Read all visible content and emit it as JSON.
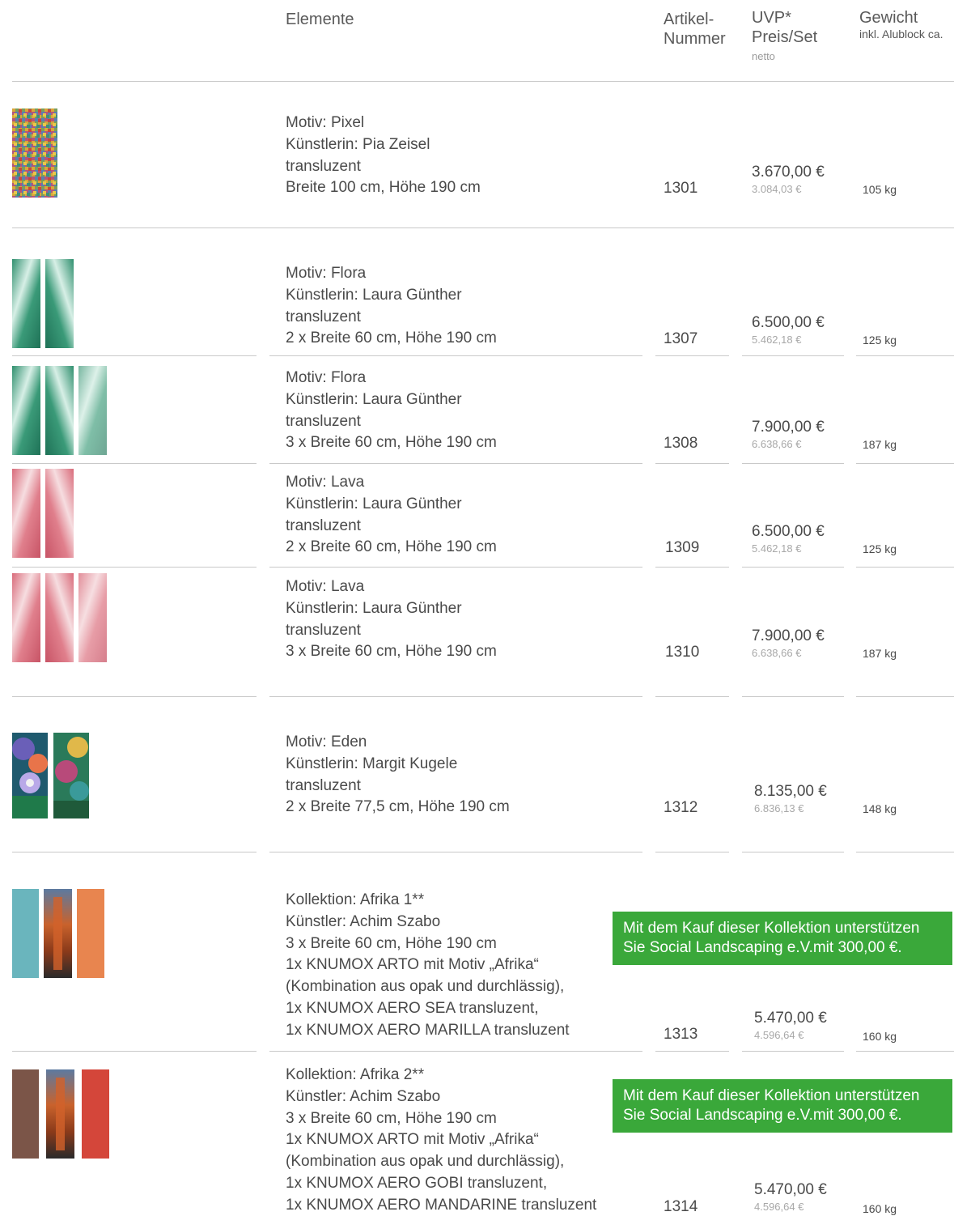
{
  "header": {
    "elements": "Elemente",
    "article_line1": "Artikel-",
    "article_line2": "Nummer",
    "price_line1": "UVP*",
    "price_line2": "Preis/Set",
    "price_net": "netto",
    "weight": "Gewicht",
    "weight_sub": "inkl. Alublock ca."
  },
  "colors": {
    "banner": "#3aa83a",
    "afrika1": [
      "#6ab5bd",
      "#e8854f"
    ],
    "afrika2": [
      "#7b5548",
      "#d4463a"
    ]
  },
  "products": [
    {
      "lines": [
        "Motiv: Pixel",
        "Künstlerin: Pia Zeisel",
        "transluzent",
        "Breite 100 cm, Höhe 190 cm"
      ],
      "article": "1301",
      "price": "3.670,00 €",
      "net": "3.084,03 €",
      "weight": "105 kg",
      "thumbnail": "pixel-mosaic"
    },
    {
      "lines": [
        "Motiv: Flora",
        "Künstlerin: Laura Günther",
        "transluzent",
        "2 x Breite 60 cm, Höhe 190 cm"
      ],
      "article": "1307",
      "price": "6.500,00 €",
      "net": "5.462,18 €",
      "weight": "125 kg",
      "thumbnail": "flora-green"
    },
    {
      "lines": [
        "Motiv: Flora",
        "Künstlerin: Laura Günther",
        "transluzent",
        "3 x Breite 60 cm, Höhe 190 cm"
      ],
      "article": "1308",
      "price": "7.900,00 €",
      "net": "6.638,66 €",
      "weight": "187 kg",
      "thumbnail": "flora-green"
    },
    {
      "lines": [
        "Motiv: Lava",
        "Künstlerin: Laura Günther",
        "transluzent",
        "2 x Breite 60 cm, Höhe 190 cm"
      ],
      "article": "1309",
      "price": "6.500,00 €",
      "net": "5.462,18 €",
      "weight": "125 kg",
      "thumbnail": "lava-pink"
    },
    {
      "lines": [
        "Motiv: Lava",
        "Künstlerin: Laura Günther",
        "transluzent",
        "3 x Breite 60 cm, Höhe 190 cm"
      ],
      "article": "1310",
      "price": "7.900,00 €",
      "net": "6.638,66 €",
      "weight": "187 kg",
      "thumbnail": "lava-pink"
    },
    {
      "lines": [
        "Motiv: Eden",
        "Künstlerin: Margit Kugele",
        "transluzent",
        "2 x Breite 77,5 cm, Höhe 190 cm"
      ],
      "article": "1312",
      "price": "8.135,00 €",
      "net": "6.836,13 €",
      "weight": "148 kg",
      "thumbnail": "eden-painting"
    },
    {
      "lines": [
        "Kollektion: Afrika 1**",
        "Künstler: Achim Szabo",
        "3 x Breite 60 cm, Höhe 190 cm",
        "1x KNUMOX ARTO mit Motiv „Afrika“",
        "(Kombination aus opak und durchlässig),",
        "1x KNUMOX AERO SEA transluzent,",
        "1x KNUMOX AERO MARILLA transluzent"
      ],
      "article": "1313",
      "price": "5.470,00 €",
      "net": "4.596,64 €",
      "weight": "160 kg",
      "banner_line1": "Mit dem Kauf dieser Kollektion unterstützen",
      "banner_line2": "Sie Social Landscaping e.V.mit 300,00 €.",
      "thumbnail": "afrika-collection"
    },
    {
      "lines": [
        "Kollektion: Afrika 2**",
        "Künstler: Achim Szabo",
        "3 x Breite 60 cm, Höhe 190 cm",
        "1x KNUMOX ARTO mit Motiv „Afrika“",
        "(Kombination aus opak und durchlässig),",
        "1x KNUMOX AERO GOBI transluzent,",
        "1x KNUMOX AERO MANDARINE transluzent"
      ],
      "article": "1314",
      "price": "5.470,00 €",
      "net": "4.596,64 €",
      "weight": "160 kg",
      "banner_line1": "Mit dem Kauf dieser Kollektion unterstützen",
      "banner_line2": "Sie Social Landscaping e.V.mit 300,00 €.",
      "thumbnail": "afrika-collection"
    }
  ]
}
